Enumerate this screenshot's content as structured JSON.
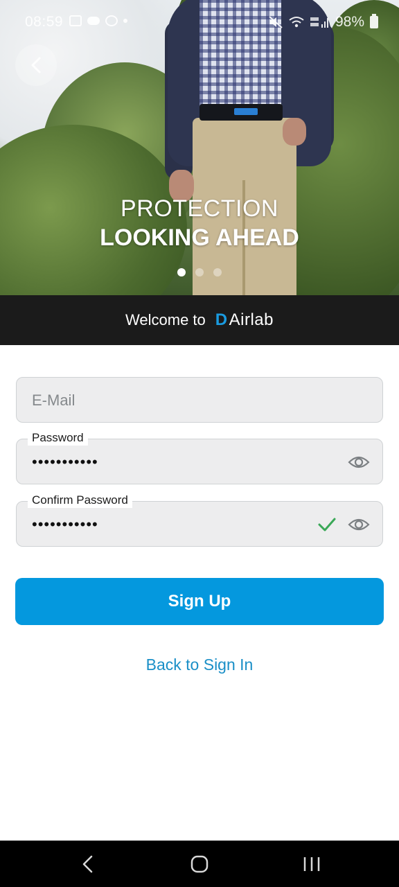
{
  "status_bar": {
    "time": "08:59",
    "battery": "98%"
  },
  "hero": {
    "title_line1": "PROTECTION",
    "title_line2": "LOOKING AHEAD",
    "slides_total": 3,
    "active_slide": 1
  },
  "welcome": {
    "text": "Welcome to",
    "logo_mark": "D",
    "logo_text": "Airlab"
  },
  "form": {
    "email": {
      "placeholder": "E-Mail",
      "value": ""
    },
    "password": {
      "label": "Password",
      "value": "•••••••••••"
    },
    "confirm_password": {
      "label": "Confirm Password",
      "value": "•••••••••••",
      "match": true
    },
    "signup_label": "Sign Up",
    "back_link": "Back to Sign In"
  },
  "colors": {
    "accent": "#0498de",
    "link": "#1a8fc7",
    "check": "#3aa857",
    "band": "#1b1b1b"
  },
  "icons": {
    "back": "chevron-left-icon",
    "eye": "eye-icon",
    "check": "checkmark-icon"
  }
}
